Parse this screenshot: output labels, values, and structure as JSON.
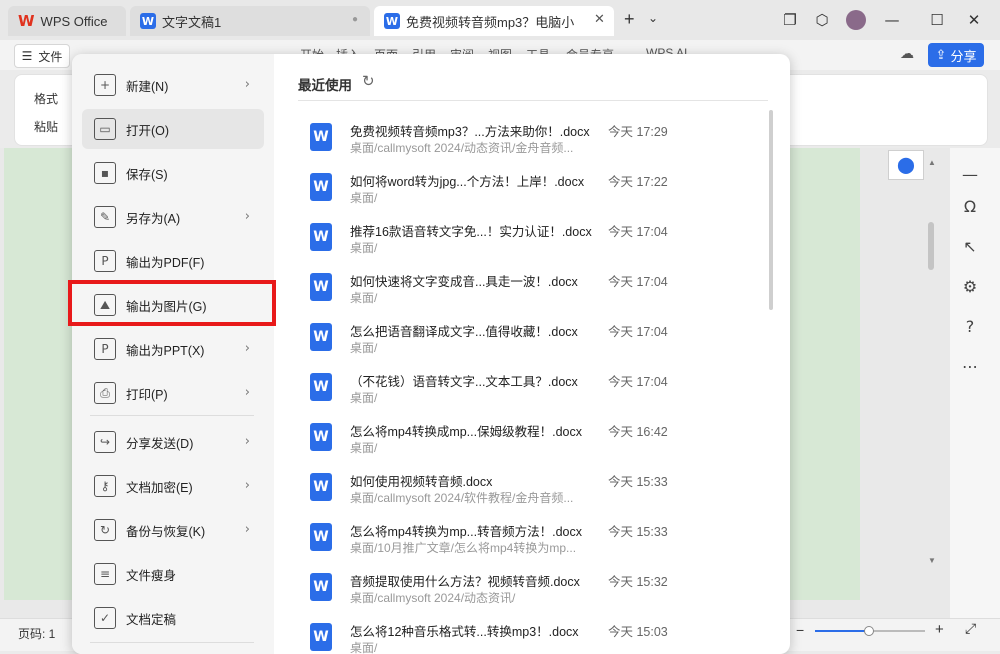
{
  "titlebar": {
    "app_tab": "WPS Office",
    "tabs": [
      {
        "label": "文字文稿1"
      },
      {
        "label": "免费视频转音频mp3？电脑小"
      }
    ],
    "new_tab": "+",
    "tab_menu": "⌄"
  },
  "menubar": {
    "file_label": "文件",
    "items": [
      "开始",
      "插入",
      "页面",
      "引用",
      "审阅",
      "视图",
      "工具",
      "会员专享",
      "WPS AI"
    ],
    "share_label": "分享"
  },
  "ribbon": {
    "small_items": [
      "格式",
      "粘贴"
    ]
  },
  "file_menu": {
    "items": [
      {
        "label": "新建(N)",
        "icon": "new-doc-icon",
        "glyph": "+",
        "has_submenu": true
      },
      {
        "label": "打开(O)",
        "icon": "folder-open-icon",
        "glyph": "▭",
        "has_submenu": false,
        "selected": true
      },
      {
        "label": "保存(S)",
        "icon": "save-icon",
        "glyph": "▪",
        "has_submenu": false
      },
      {
        "label": "另存为(A)",
        "icon": "save-as-icon",
        "glyph": "✎",
        "has_submenu": true
      },
      {
        "label": "输出为PDF(F)",
        "icon": "export-pdf-icon",
        "glyph": "P",
        "has_submenu": false
      },
      {
        "label": "输出为图片(G)",
        "icon": "export-image-icon",
        "glyph": "⛰",
        "has_submenu": false
      },
      {
        "label": "输出为PPT(X)",
        "icon": "export-ppt-icon",
        "glyph": "P",
        "has_submenu": true
      },
      {
        "label": "打印(P)",
        "icon": "print-icon",
        "glyph": "⎙",
        "has_submenu": true
      },
      {
        "label": "分享发送(D)",
        "icon": "share-send-icon",
        "glyph": "↪",
        "has_submenu": true
      },
      {
        "label": "文档加密(E)",
        "icon": "encrypt-icon",
        "glyph": "⚷",
        "has_submenu": true
      },
      {
        "label": "备份与恢复(K)",
        "icon": "backup-icon",
        "glyph": "↻",
        "has_submenu": true
      },
      {
        "label": "文件瘦身",
        "icon": "slim-file-icon",
        "glyph": "≡",
        "has_submenu": false
      },
      {
        "label": "文档定稿",
        "icon": "finalize-icon",
        "glyph": "✓",
        "has_submenu": false
      }
    ],
    "submenu_glyph": "›"
  },
  "recent": {
    "title": "最近使用",
    "files": [
      {
        "name": "免费视频转音频mp3？...方法来助你！.docx",
        "path": "桌面/callmysoft 2024/动态资讯/金舟音频...",
        "time": "今天 17:29"
      },
      {
        "name": "如何将word转为jpg...个方法！上岸！.docx",
        "path": "桌面/",
        "time": "今天 17:22"
      },
      {
        "name": "推荐16款语音转文字免...！实力认证！.docx",
        "path": "桌面/",
        "time": "今天 17:04"
      },
      {
        "name": "如何快速将文字变成音...具走一波！.docx",
        "path": "桌面/",
        "time": "今天 17:04"
      },
      {
        "name": "怎么把语音翻译成文字...值得收藏！.docx",
        "path": "桌面/",
        "time": "今天 17:04"
      },
      {
        "name": "（不花钱）语音转文字...文本工具？.docx",
        "path": "桌面/",
        "time": "今天 17:04"
      },
      {
        "name": "怎么将mp4转换成mp...保姆级教程！.docx",
        "path": "桌面/",
        "time": "今天 16:42"
      },
      {
        "name": "如何使用视频转音频.docx",
        "path": "桌面/callmysoft 2024/软件教程/金舟音频...",
        "time": "今天 15:33"
      },
      {
        "name": "怎么将mp4转换为mp...转音频方法！.docx",
        "path": "桌面/10月推广文章/怎么将mp4转换为mp...",
        "time": "今天 15:33"
      },
      {
        "name": "音频提取使用什么方法？视频转音频.docx",
        "path": "桌面/callmysoft 2024/动态资讯/",
        "time": "今天 15:32"
      },
      {
        "name": "怎么将12种音乐格式转...转换mp3！.docx",
        "path": "桌面/",
        "time": "今天 15:03"
      }
    ]
  },
  "statusbar": {
    "page_label": "页码: 1"
  },
  "colors": {
    "accent": "#2b6de8",
    "highlight": "#e8191a",
    "page_bg": "#d7e8d5"
  }
}
